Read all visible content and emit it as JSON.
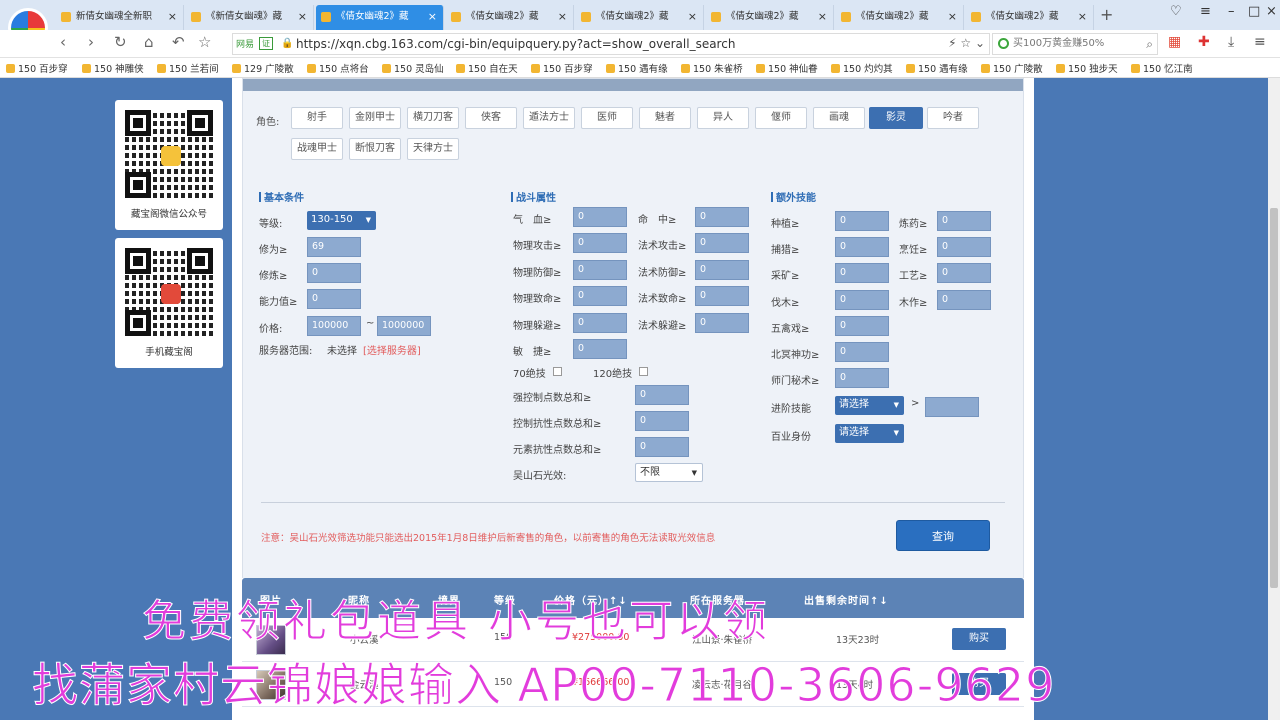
{
  "tabs": [
    {
      "label": "新倩女幽魂全新职",
      "active": false
    },
    {
      "label": "《新倩女幽魂》藏",
      "active": false
    },
    {
      "label": "《倩女幽魂2》藏",
      "active": true
    },
    {
      "label": "《倩女幽魂2》藏",
      "active": false
    },
    {
      "label": "《倩女幽魂2》藏",
      "active": false
    },
    {
      "label": "《倩女幽魂2》藏",
      "active": false
    },
    {
      "label": "《倩女幽魂2》藏",
      "active": false
    },
    {
      "label": "《倩女幽魂2》藏",
      "active": false
    }
  ],
  "address": {
    "badge": "网易",
    "badge2": "证",
    "url": "https://xqn.cbg.163.com/cgi-bin/equipquery.py?act=show_overall_search"
  },
  "search": {
    "placeholder": "买100万黄金赚50%"
  },
  "bookmarks": [
    "150 百步穿",
    "150 神雕侠",
    "150 兰若间",
    "129 广陵散",
    "150 点将台",
    "150 灵岛仙",
    "150 自在天",
    "150 百步穿",
    "150 遇有缘",
    "150 朱雀桥",
    "150 神仙眷",
    "150 灼灼其",
    "150 遇有缘",
    "150 广陵散",
    "150 独步天",
    "150 忆江南"
  ],
  "sidebar": {
    "qr1_label": "藏宝阁微信公众号",
    "qr2_label": "手机藏宝阁"
  },
  "roles": {
    "label": "角色:",
    "items": [
      "射手",
      "金刚甲士",
      "横刀刀客",
      "侠客",
      "遁法方士",
      "医师",
      "魅者",
      "异人",
      "偃师",
      "画魂",
      "影灵",
      "吟者",
      "战魂甲士",
      "断恨刀客",
      "天律方士"
    ],
    "active_index": 10
  },
  "basic": {
    "title": "基本条件",
    "level_label": "等级:",
    "level_value": "130-150",
    "xiuwei_label": "修为≥",
    "xiuwei_value": "69",
    "xiulian_label": "修炼≥",
    "xiulian_value": "0",
    "ability_label": "能力值≥",
    "ability_value": "0",
    "price_label": "价格:",
    "price_min": "100000",
    "price_sep": "~",
    "price_max": "1000000",
    "server_label": "服务器范围:",
    "server_value": "未选择",
    "server_link": "[选择服务器]"
  },
  "combat": {
    "title": "战斗属性",
    "qixue_label": "气　血≥",
    "qixue_value": "0",
    "mingzhong_label": "命　中≥",
    "mingzhong_value": "0",
    "wugong_label": "物理攻击≥",
    "wugong_value": "0",
    "fagong_label": "法术攻击≥",
    "fagong_value": "0",
    "wufang_label": "物理防御≥",
    "wufang_value": "0",
    "fafang_label": "法术防御≥",
    "fafang_value": "0",
    "wuzhi_label": "物理致命≥",
    "wuzhi_value": "0",
    "fazhi_label": "法术致命≥",
    "fazhi_value": "0",
    "wuduo_label": "物理躲避≥",
    "wuduo_value": "0",
    "faduo_label": "法术躲避≥",
    "faduo_value": "0",
    "minjie_label": "敏　捷≥",
    "minjie_value": "0",
    "jueji70_label": "70绝技",
    "jueji120_label": "120绝技",
    "qiangkong_label": "强控制点数总和≥",
    "qiangkong_value": "0",
    "kongkang_label": "控制抗性点数总和≥",
    "kongkang_value": "0",
    "yuansu_label": "元素抗性点数总和≥",
    "yuansu_value": "0",
    "wushan_label": "吴山石光效:",
    "wushan_value": "不限"
  },
  "extra": {
    "title": "额外技能",
    "zhongzhi_label": "种植≥",
    "zhongzhi_value": "0",
    "lianyao_label": "炼药≥",
    "lianyao_value": "0",
    "buzhuo_label": "捕猎≥",
    "buzhuo_value": "0",
    "pengren_label": "烹饪≥",
    "pengren_value": "0",
    "caikuang_label": "采矿≥",
    "caikuang_value": "0",
    "gongyi_label": "工艺≥",
    "gongyi_value": "0",
    "famu_label": "伐木≥",
    "famu_value": "0",
    "muzuo_label": "木作≥",
    "muzuo_value": "0",
    "wuqinxi_label": "五禽戏≥",
    "wuqinxi_value": "0",
    "beiming_label": "北冥神功≥",
    "beiming_value": "0",
    "shimen_label": "师门秘术≥",
    "shimen_value": "0",
    "jinjie_label": "进阶技能",
    "jinjie_value": "请选择",
    "jinjie_gt": ">",
    "baiye_label": "百业身份",
    "baiye_value": "请选择"
  },
  "note": "注意：吴山石光效筛选功能只能选出2015年1月8日维护后新寄售的角色，以前寄售的角色无法读取光效信息",
  "query_button": "查询",
  "results": {
    "headers": [
      "图片",
      "昵称",
      "境界",
      "等级",
      "价格（元）↑↓",
      "所在服务器",
      "出售剩余时间↑↓"
    ],
    "rows": [
      {
        "name": "小云溪",
        "level": "150",
        "price": "¥275000.00",
        "server": "江山景·朱雀桥",
        "time": "13天23时",
        "buy": "购买"
      },
      {
        "name": "金云溪",
        "level": "150",
        "price": "¥166666.00",
        "server": "凌云志·花月谷",
        "time": "13天4时",
        "buy": "购买"
      }
    ]
  },
  "watermark": {
    "line1": "免费领礼包道具 小号也可以领",
    "line2": "找蒲家村云锦娘娘输入 AP00-7110-3606-9629"
  },
  "colors": {
    "accent": "#3c6fb1",
    "page_bg": "#4a78b5",
    "watermark": "#e23cdc"
  }
}
